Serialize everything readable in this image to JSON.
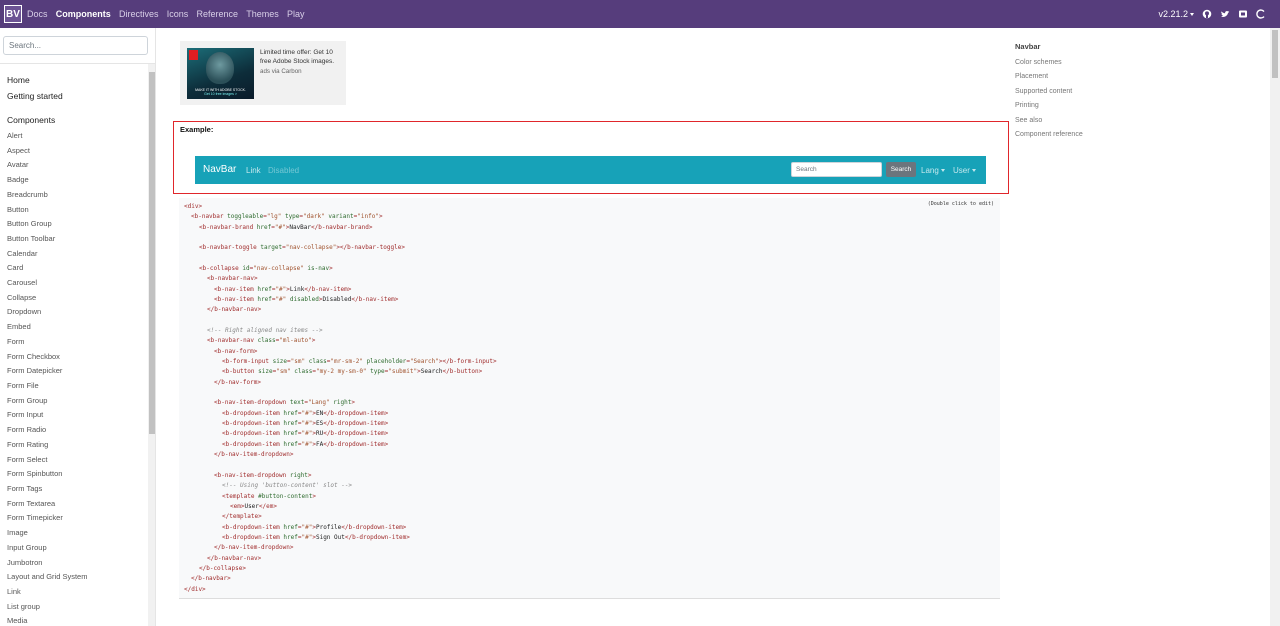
{
  "topbar": {
    "brand": "BV",
    "nav": [
      "Docs",
      "Components",
      "Directives",
      "Icons",
      "Reference",
      "Themes",
      "Play"
    ],
    "active": "Components",
    "version": "v2.21.2",
    "icons": [
      "github-icon",
      "twitter-icon",
      "slack-icon",
      "opencollective-icon"
    ]
  },
  "sidebar": {
    "search_placeholder": "Search...",
    "top_items": [
      "Home",
      "Getting started"
    ],
    "section_header": "Components",
    "items": [
      "Alert",
      "Aspect",
      "Avatar",
      "Badge",
      "Breadcrumb",
      "Button",
      "Button Group",
      "Button Toolbar",
      "Calendar",
      "Card",
      "Carousel",
      "Collapse",
      "Dropdown",
      "Embed",
      "Form",
      "Form Checkbox",
      "Form Datepicker",
      "Form File",
      "Form Group",
      "Form Input",
      "Form Radio",
      "Form Rating",
      "Form Select",
      "Form Spinbutton",
      "Form Tags",
      "Form Textarea",
      "Form Timepicker",
      "Image",
      "Input Group",
      "Jumbotron",
      "Layout and Grid System",
      "Link",
      "List group",
      "Media"
    ]
  },
  "ad": {
    "text": "Limited time offer: Get 10 free Adobe Stock images.",
    "via": "ads via Carbon",
    "img_caption": "MAKE IT WITH ADOBE STOCK.",
    "img_button": "Get 10 free images >"
  },
  "example": {
    "label": "Example:",
    "brand": "NavBar",
    "link": "Link",
    "disabled": "Disabled",
    "search_placeholder": "Search",
    "search_button": "Search",
    "lang": "Lang",
    "user": "User"
  },
  "code": {
    "hint": "(Double click to edit)"
  },
  "toc": {
    "title": "Navbar",
    "items": [
      "Color schemes",
      "Placement",
      "Supported content",
      "Printing",
      "See also",
      "Component reference"
    ]
  },
  "colors": {
    "brand_purple": "#563d7c",
    "navbar_info": "#17a2b8",
    "highlight_red": "#e0262b"
  }
}
